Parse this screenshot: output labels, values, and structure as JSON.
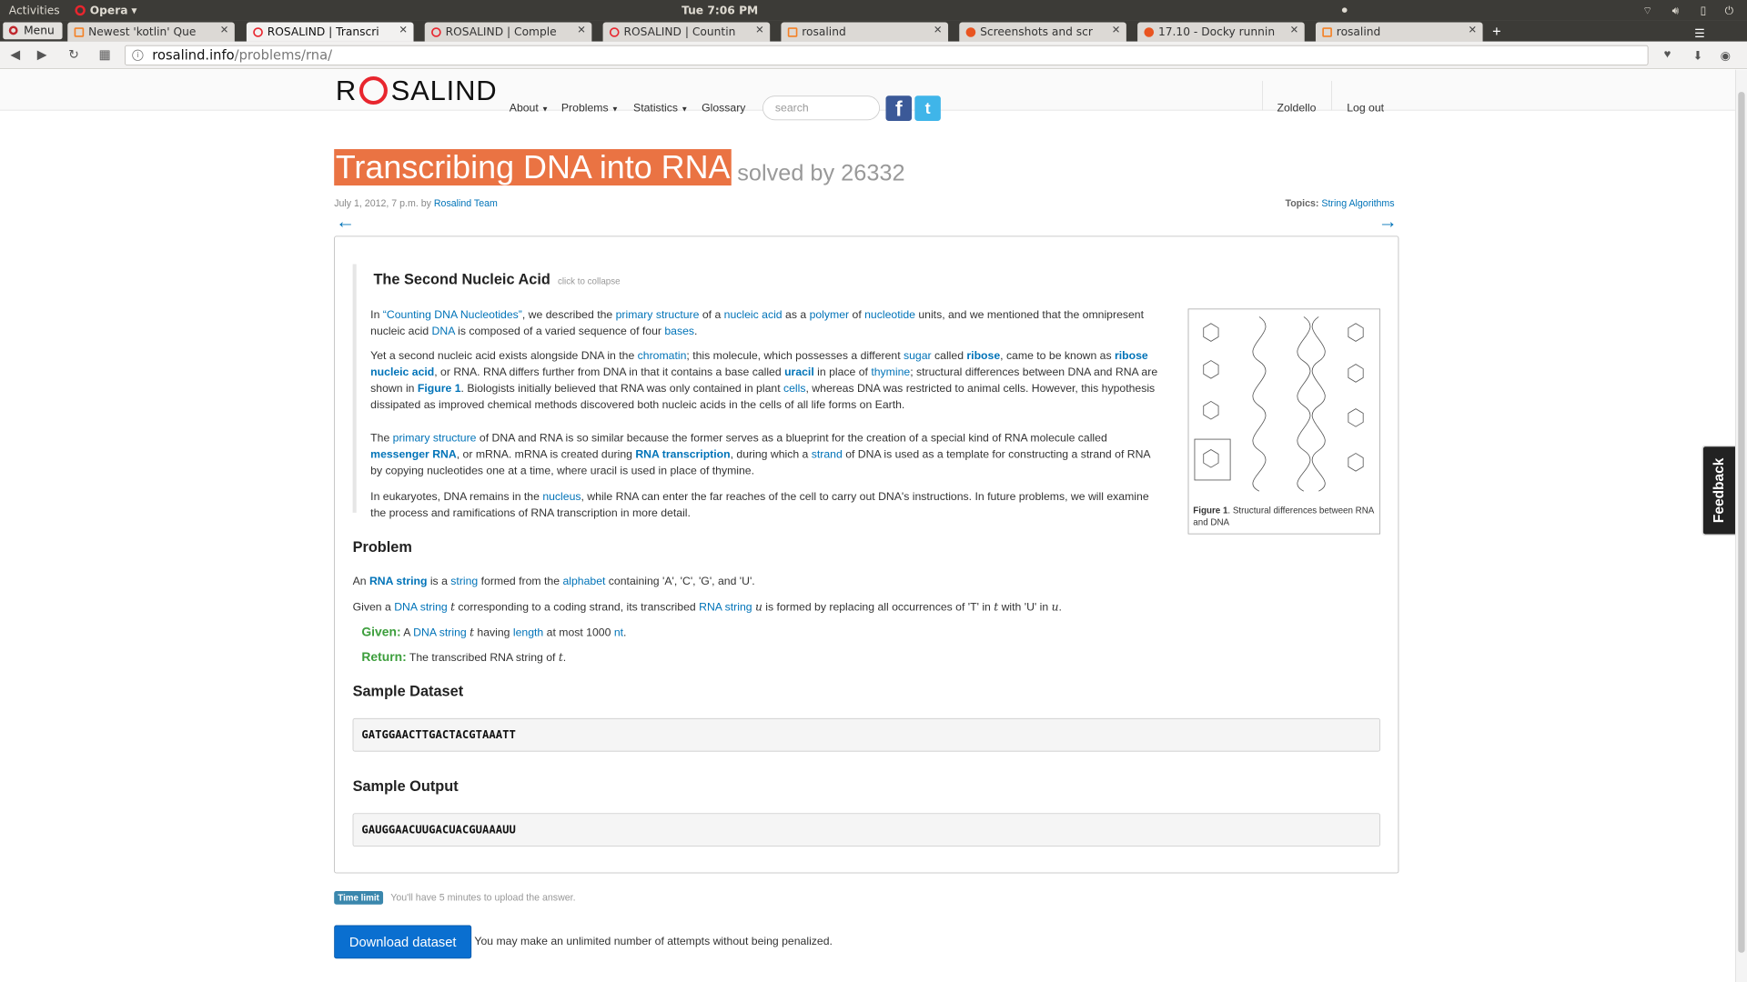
{
  "system": {
    "activities": "Activities",
    "app": "Opera",
    "clock": "Tue  7:06 PM"
  },
  "browser": {
    "menu": "Menu",
    "tabs": [
      {
        "label": "Newest 'kotlin' Que",
        "icon": "stackoverflow-icon"
      },
      {
        "label": "ROSALIND | Transcri",
        "icon": "rosalind-icon"
      },
      {
        "label": "ROSALIND | Comple",
        "icon": "rosalind-icon"
      },
      {
        "label": "ROSALIND | Countin",
        "icon": "rosalind-icon"
      },
      {
        "label": "rosalind",
        "icon": "loading-icon"
      },
      {
        "label": "Screenshots and scr",
        "icon": "ubuntu-icon"
      },
      {
        "label": "17.10 - Docky runnin",
        "icon": "askubuntu-icon"
      },
      {
        "label": "rosalind",
        "icon": "loading-icon"
      }
    ],
    "url_host": "rosalind.info",
    "url_path": "/problems/rna/"
  },
  "site": {
    "logo_left": "R",
    "logo_right": "SALIND",
    "nav": [
      "About",
      "Problems",
      "Statistics",
      "Glossary"
    ],
    "search_placeholder": "search",
    "user": "Zoldello",
    "logout": "Log out"
  },
  "problem": {
    "title": "Transcribing DNA into RNA",
    "solved": "solved by 26332",
    "date": "July 1, 2012, 7 p.m. by",
    "author": "Rosalind Team",
    "topics_label": "Topics:",
    "topics": "String Algorithms",
    "prev": "←",
    "next": "→",
    "story_title": "The Second Nucleic Acid",
    "collapse": "click to collapse",
    "figure_label": "Figure 1",
    "figure_caption": ". Structural differences between RNA and DNA",
    "problem_heading": "Problem",
    "given_label": "Given:",
    "return_label": "Return:",
    "sample_dataset_heading": "Sample Dataset",
    "sample_dataset": "GATGGAACTTGACTACGTAAATT",
    "sample_output_heading": "Sample Output",
    "sample_output": "GAUGGAACUUGACUACGUAAAUU",
    "time_limit": "Time limit",
    "time_text": "You'll have 5 minutes to upload the answer.",
    "download": "Download dataset",
    "attempts": "You may make an unlimited number of attempts without being penalized."
  },
  "feedback": "Feedback"
}
